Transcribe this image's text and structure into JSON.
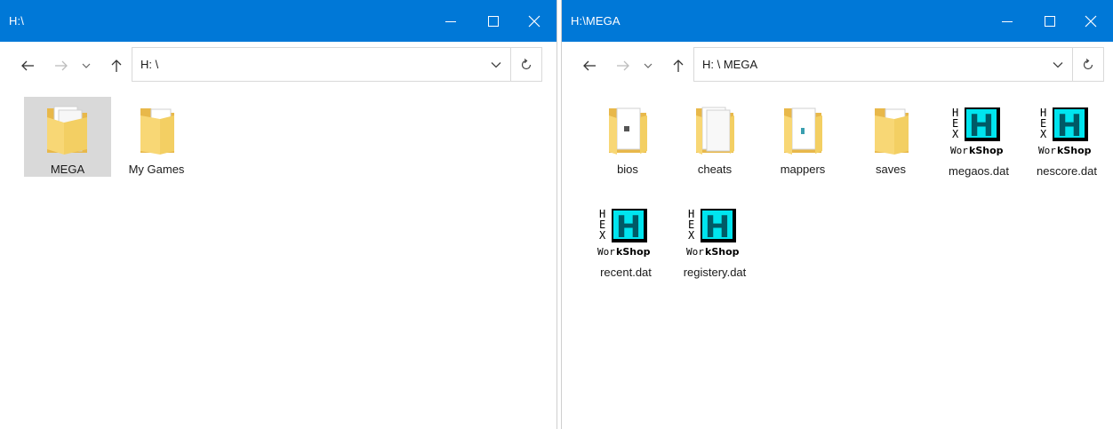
{
  "window_left": {
    "title": "H:\\",
    "address": "H: \\",
    "items": [
      {
        "label": "MEGA",
        "icon": "folder-icon",
        "selected": true
      },
      {
        "label": "My Games",
        "icon": "folder-icon",
        "selected": false
      }
    ]
  },
  "window_right": {
    "title": "H:\\MEGA",
    "address": "H: \\ MEGA",
    "items": [
      {
        "label": "bios",
        "icon": "folder-icon"
      },
      {
        "label": "cheats",
        "icon": "folder-icon"
      },
      {
        "label": "mappers",
        "icon": "folder-icon"
      },
      {
        "label": "saves",
        "icon": "folder-icon"
      },
      {
        "label": "megaos.dat",
        "icon": "hex-workshop-icon"
      },
      {
        "label": "nescore.dat",
        "icon": "hex-workshop-icon"
      },
      {
        "label": "recent.dat",
        "icon": "hex-workshop-icon"
      },
      {
        "label": "registery.dat",
        "icon": "hex-workshop-icon"
      }
    ]
  },
  "icon_text": {
    "hex_letters": [
      "H",
      "E",
      "X"
    ],
    "big_letter": "H",
    "workshop_prefix": "Wor",
    "workshop_suffix": "kShop"
  },
  "colors": {
    "title_bar": "#0078d7",
    "selection": "#d9d9d9",
    "folder": "#f6d675",
    "hex_cyan": "#00e5ef"
  }
}
